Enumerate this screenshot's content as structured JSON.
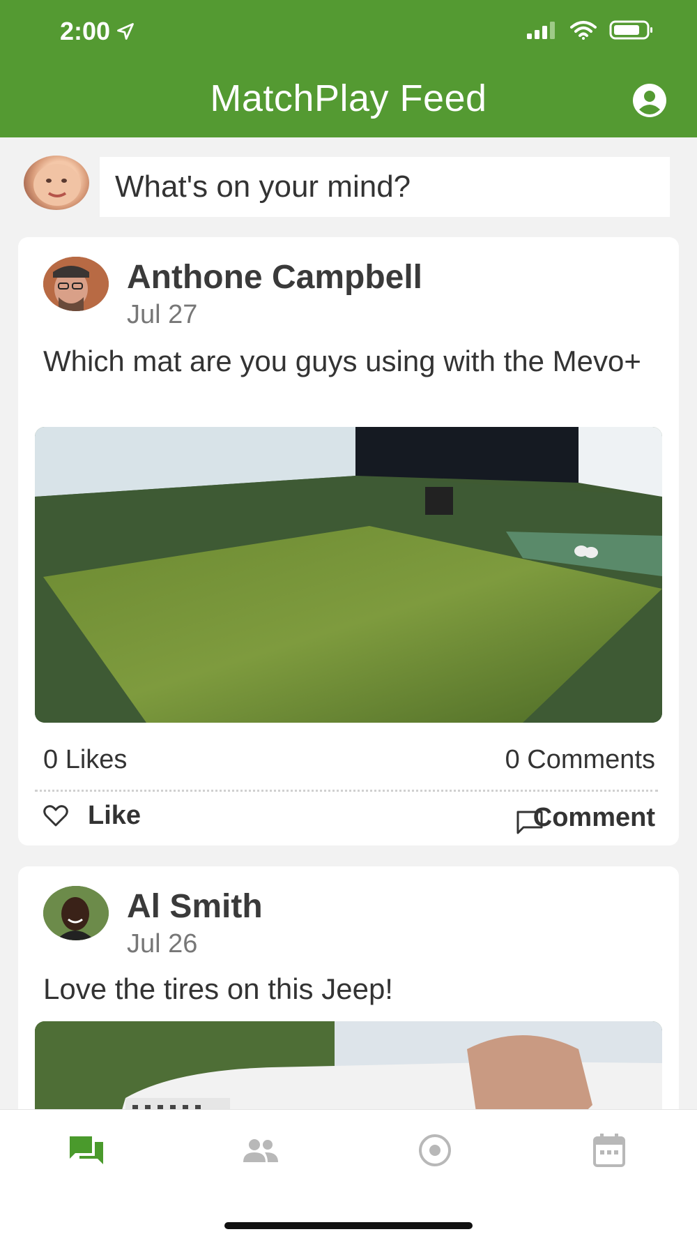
{
  "status_bar": {
    "time": "2:00"
  },
  "header": {
    "title": "MatchPlay Feed"
  },
  "composer": {
    "placeholder": "What's on your mind?"
  },
  "posts": [
    {
      "author": "Anthone Campbell",
      "date": "Jul 27",
      "text": "Which mat are you guys using with the Mevo+",
      "likes": "0 Likes",
      "comments": "0 Comments",
      "like_label": "Like",
      "comment_label": "Comment"
    },
    {
      "author": "Al Smith",
      "date": "Jul 26",
      "text": "Love the tires on this Jeep!"
    }
  ],
  "tabs": [
    "feed-icon",
    "people-icon",
    "target-icon",
    "calendar-icon"
  ],
  "colors": {
    "brand": "#549a32",
    "active_tab": "#4a9a2c",
    "inactive_tab": "#b8b8b8"
  }
}
